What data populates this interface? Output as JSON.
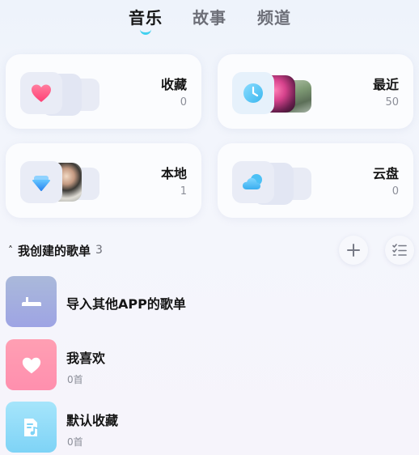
{
  "tabs": [
    {
      "label": "音乐",
      "active": true
    },
    {
      "label": "故事",
      "active": false
    },
    {
      "label": "频道",
      "active": false
    }
  ],
  "cards": {
    "favorites": {
      "title": "收藏",
      "count": "0",
      "icon": "heart-icon"
    },
    "recent": {
      "title": "最近",
      "count": "50",
      "icon": "clock-icon"
    },
    "local": {
      "title": "本地",
      "count": "1",
      "icon": "diamond-icon"
    },
    "cloud": {
      "title": "云盘",
      "count": "0",
      "icon": "cloud-icon"
    }
  },
  "section": {
    "caret": "˄",
    "title": "我创建的歌单",
    "count": "3"
  },
  "playlists": [
    {
      "name": "导入其他APP的歌单",
      "sub": "",
      "color_top": "#a9b9db",
      "color_bottom": "#9ea5e4",
      "icon": "import-icon"
    },
    {
      "name": "我喜欢",
      "sub": "0首",
      "color_top": "#ff9eb2",
      "color_bottom": "#ff8fae",
      "icon": "heart-icon"
    },
    {
      "name": "默认收藏",
      "sub": "0首",
      "color_top": "#a3e4fa",
      "color_bottom": "#7fd3f6",
      "icon": "music-note-icon"
    }
  ],
  "colors": {
    "accent": "#3fd0ef",
    "heart_pink": "#ff4f7e",
    "clock_blue": "#5cc6f4"
  }
}
